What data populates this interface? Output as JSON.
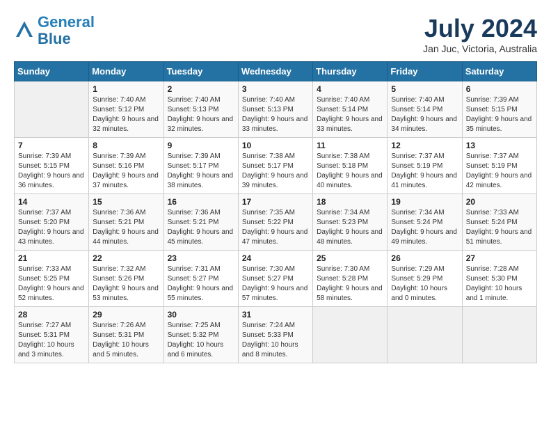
{
  "header": {
    "logo_line1": "General",
    "logo_line2": "Blue",
    "month": "July 2024",
    "location": "Jan Juc, Victoria, Australia"
  },
  "days_of_week": [
    "Sunday",
    "Monday",
    "Tuesday",
    "Wednesday",
    "Thursday",
    "Friday",
    "Saturday"
  ],
  "weeks": [
    [
      {
        "day": "",
        "sunrise": "",
        "sunset": "",
        "daylight": ""
      },
      {
        "day": "1",
        "sunrise": "Sunrise: 7:40 AM",
        "sunset": "Sunset: 5:12 PM",
        "daylight": "Daylight: 9 hours and 32 minutes."
      },
      {
        "day": "2",
        "sunrise": "Sunrise: 7:40 AM",
        "sunset": "Sunset: 5:13 PM",
        "daylight": "Daylight: 9 hours and 32 minutes."
      },
      {
        "day": "3",
        "sunrise": "Sunrise: 7:40 AM",
        "sunset": "Sunset: 5:13 PM",
        "daylight": "Daylight: 9 hours and 33 minutes."
      },
      {
        "day": "4",
        "sunrise": "Sunrise: 7:40 AM",
        "sunset": "Sunset: 5:14 PM",
        "daylight": "Daylight: 9 hours and 33 minutes."
      },
      {
        "day": "5",
        "sunrise": "Sunrise: 7:40 AM",
        "sunset": "Sunset: 5:14 PM",
        "daylight": "Daylight: 9 hours and 34 minutes."
      },
      {
        "day": "6",
        "sunrise": "Sunrise: 7:39 AM",
        "sunset": "Sunset: 5:15 PM",
        "daylight": "Daylight: 9 hours and 35 minutes."
      }
    ],
    [
      {
        "day": "7",
        "sunrise": "Sunrise: 7:39 AM",
        "sunset": "Sunset: 5:15 PM",
        "daylight": "Daylight: 9 hours and 36 minutes."
      },
      {
        "day": "8",
        "sunrise": "Sunrise: 7:39 AM",
        "sunset": "Sunset: 5:16 PM",
        "daylight": "Daylight: 9 hours and 37 minutes."
      },
      {
        "day": "9",
        "sunrise": "Sunrise: 7:39 AM",
        "sunset": "Sunset: 5:17 PM",
        "daylight": "Daylight: 9 hours and 38 minutes."
      },
      {
        "day": "10",
        "sunrise": "Sunrise: 7:38 AM",
        "sunset": "Sunset: 5:17 PM",
        "daylight": "Daylight: 9 hours and 39 minutes."
      },
      {
        "day": "11",
        "sunrise": "Sunrise: 7:38 AM",
        "sunset": "Sunset: 5:18 PM",
        "daylight": "Daylight: 9 hours and 40 minutes."
      },
      {
        "day": "12",
        "sunrise": "Sunrise: 7:37 AM",
        "sunset": "Sunset: 5:19 PM",
        "daylight": "Daylight: 9 hours and 41 minutes."
      },
      {
        "day": "13",
        "sunrise": "Sunrise: 7:37 AM",
        "sunset": "Sunset: 5:19 PM",
        "daylight": "Daylight: 9 hours and 42 minutes."
      }
    ],
    [
      {
        "day": "14",
        "sunrise": "Sunrise: 7:37 AM",
        "sunset": "Sunset: 5:20 PM",
        "daylight": "Daylight: 9 hours and 43 minutes."
      },
      {
        "day": "15",
        "sunrise": "Sunrise: 7:36 AM",
        "sunset": "Sunset: 5:21 PM",
        "daylight": "Daylight: 9 hours and 44 minutes."
      },
      {
        "day": "16",
        "sunrise": "Sunrise: 7:36 AM",
        "sunset": "Sunset: 5:21 PM",
        "daylight": "Daylight: 9 hours and 45 minutes."
      },
      {
        "day": "17",
        "sunrise": "Sunrise: 7:35 AM",
        "sunset": "Sunset: 5:22 PM",
        "daylight": "Daylight: 9 hours and 47 minutes."
      },
      {
        "day": "18",
        "sunrise": "Sunrise: 7:34 AM",
        "sunset": "Sunset: 5:23 PM",
        "daylight": "Daylight: 9 hours and 48 minutes."
      },
      {
        "day": "19",
        "sunrise": "Sunrise: 7:34 AM",
        "sunset": "Sunset: 5:24 PM",
        "daylight": "Daylight: 9 hours and 49 minutes."
      },
      {
        "day": "20",
        "sunrise": "Sunrise: 7:33 AM",
        "sunset": "Sunset: 5:24 PM",
        "daylight": "Daylight: 9 hours and 51 minutes."
      }
    ],
    [
      {
        "day": "21",
        "sunrise": "Sunrise: 7:33 AM",
        "sunset": "Sunset: 5:25 PM",
        "daylight": "Daylight: 9 hours and 52 minutes."
      },
      {
        "day": "22",
        "sunrise": "Sunrise: 7:32 AM",
        "sunset": "Sunset: 5:26 PM",
        "daylight": "Daylight: 9 hours and 53 minutes."
      },
      {
        "day": "23",
        "sunrise": "Sunrise: 7:31 AM",
        "sunset": "Sunset: 5:27 PM",
        "daylight": "Daylight: 9 hours and 55 minutes."
      },
      {
        "day": "24",
        "sunrise": "Sunrise: 7:30 AM",
        "sunset": "Sunset: 5:27 PM",
        "daylight": "Daylight: 9 hours and 57 minutes."
      },
      {
        "day": "25",
        "sunrise": "Sunrise: 7:30 AM",
        "sunset": "Sunset: 5:28 PM",
        "daylight": "Daylight: 9 hours and 58 minutes."
      },
      {
        "day": "26",
        "sunrise": "Sunrise: 7:29 AM",
        "sunset": "Sunset: 5:29 PM",
        "daylight": "Daylight: 10 hours and 0 minutes."
      },
      {
        "day": "27",
        "sunrise": "Sunrise: 7:28 AM",
        "sunset": "Sunset: 5:30 PM",
        "daylight": "Daylight: 10 hours and 1 minute."
      }
    ],
    [
      {
        "day": "28",
        "sunrise": "Sunrise: 7:27 AM",
        "sunset": "Sunset: 5:31 PM",
        "daylight": "Daylight: 10 hours and 3 minutes."
      },
      {
        "day": "29",
        "sunrise": "Sunrise: 7:26 AM",
        "sunset": "Sunset: 5:31 PM",
        "daylight": "Daylight: 10 hours and 5 minutes."
      },
      {
        "day": "30",
        "sunrise": "Sunrise: 7:25 AM",
        "sunset": "Sunset: 5:32 PM",
        "daylight": "Daylight: 10 hours and 6 minutes."
      },
      {
        "day": "31",
        "sunrise": "Sunrise: 7:24 AM",
        "sunset": "Sunset: 5:33 PM",
        "daylight": "Daylight: 10 hours and 8 minutes."
      },
      {
        "day": "",
        "sunrise": "",
        "sunset": "",
        "daylight": ""
      },
      {
        "day": "",
        "sunrise": "",
        "sunset": "",
        "daylight": ""
      },
      {
        "day": "",
        "sunrise": "",
        "sunset": "",
        "daylight": ""
      }
    ]
  ]
}
